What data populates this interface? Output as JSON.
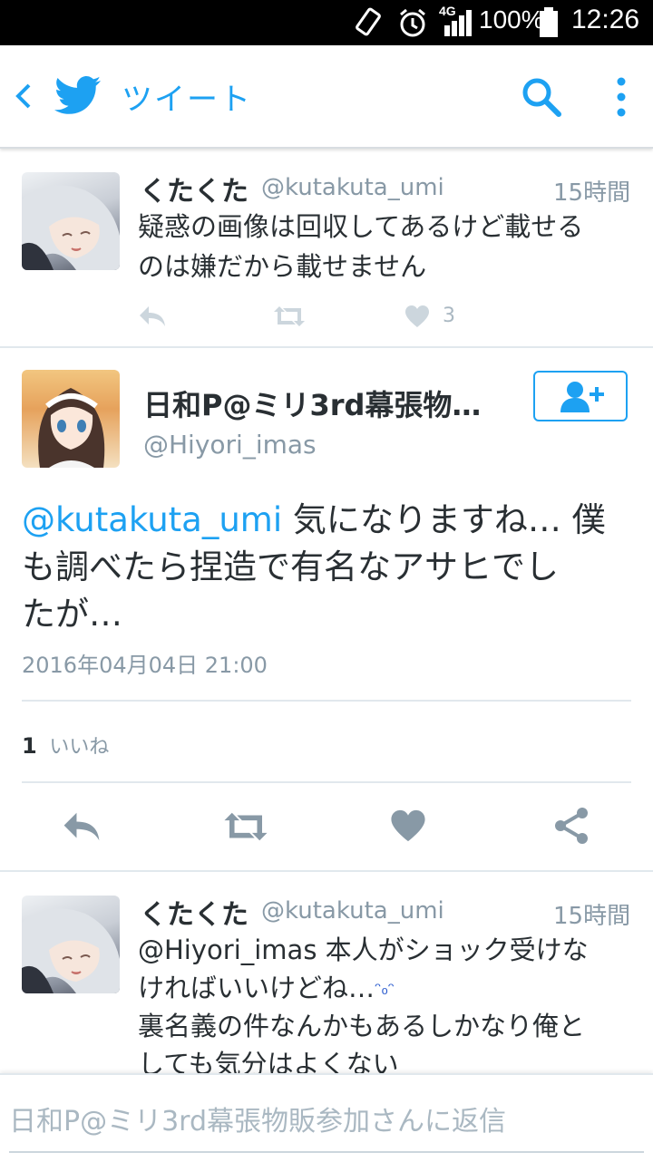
{
  "status_bar": {
    "network": "4G",
    "battery": "100%",
    "time": "12:26"
  },
  "toolbar": {
    "title": "ツイート"
  },
  "tweet1": {
    "name": "くたくた",
    "handle": "@kutakuta_umi",
    "time": "15時間",
    "text_line1": "疑惑の画像は回収してあるけど載せる",
    "text_line2": "のは嫌だから載せません",
    "like_count": "3"
  },
  "main_tweet": {
    "name": "日和P@ミリ3rd幕張物…",
    "handle": "@Hiyori_imas",
    "mention": "@kutakuta_umi",
    "text_line1_rest": " 気になりますね… 僕",
    "text_line2": "も調べたら捏造で有名なアサヒでし",
    "text_line3": "たが…",
    "date": "2016年04月04日 21:00",
    "likes_count": "1",
    "likes_label": "いいね"
  },
  "tweet2": {
    "name": "くたくた",
    "handle": "@kutakuta_umi",
    "time": "15時間",
    "text_line1": "@Hiyori_imas 本人がショック受けな",
    "text_line2": "ければいいけどね…",
    "emoji": "ᵔ₀ᵔ",
    "text_line3": "裏名義の件なんかもあるしかなり俺と",
    "text_line4": "しても気分はよくない"
  },
  "reply_box": {
    "placeholder": "日和P@ミリ3rd幕張物販参加さんに返信"
  },
  "colors": {
    "accent": "#1da1f2",
    "icon_grey": "#8899a6",
    "divider": "#e1e8ed"
  }
}
